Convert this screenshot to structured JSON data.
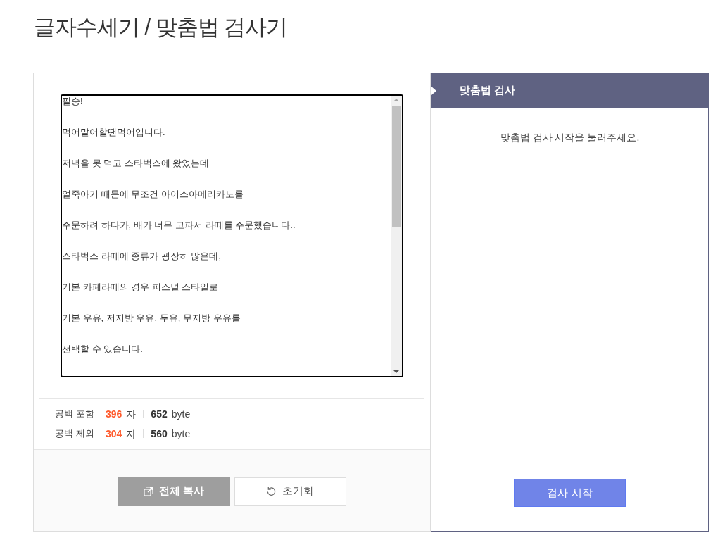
{
  "page_title": "글자수세기 / 맞춤법 검사기",
  "editor": {
    "lines": [
      "필승!",
      "먹어말어할땐먹어입니다.",
      "저녁을 못 먹고 스타벅스에 왔었는데",
      "얼죽아기 때문에 무조건 아이스아메리카노를",
      "주문하려 하다가, 배가 너무 고파서 라떼를 주문했습니다..",
      "스타벅스 라떼에 종류가 굉장히 많은데,",
      "기본 카페라떼의 경우 퍼스널 스타일로",
      "기본 우유, 저지방 우유, 두유, 무지방 우유를",
      "선택할 수 있습니다."
    ]
  },
  "stats": [
    {
      "label": "공백 포함",
      "count": "396",
      "unit": "자",
      "bytes": "652",
      "bytes_unit": "byte"
    },
    {
      "label": "공백 제외",
      "count": "304",
      "unit": "자",
      "bytes": "560",
      "bytes_unit": "byte"
    }
  ],
  "buttons": [
    {
      "kind": "copy",
      "label": "전체 복사"
    },
    {
      "kind": "reset",
      "label": "초기화"
    }
  ],
  "spell_panel": {
    "title": "맞춤법 검사",
    "message": "맞춤법 검사 시작을 눌러주세요.",
    "button": "검사 시작"
  }
}
